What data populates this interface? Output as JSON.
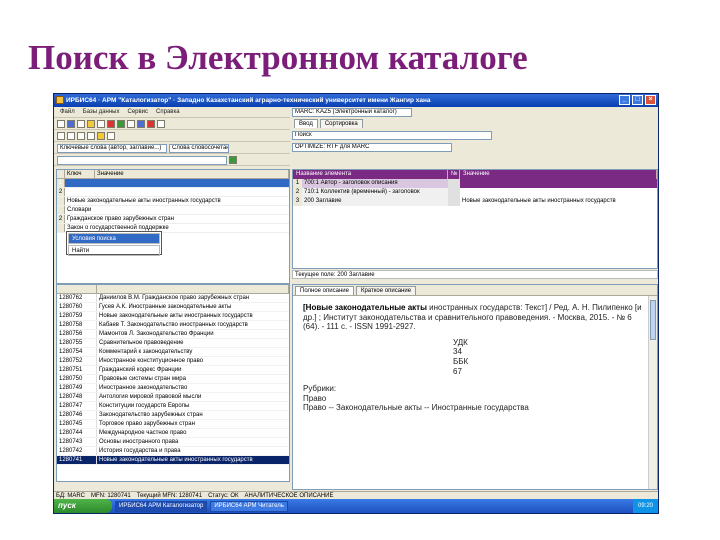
{
  "slide_title": "Поиск в Электронном каталоге",
  "window": {
    "title": "ИРБИС64 · АРМ \"Каталогизатор\" · Западно Казахстанский аграрно-технический университет имени Жангир хана",
    "minimize": "_",
    "maximize": "□",
    "close": "×"
  },
  "menu": [
    "Файл",
    "Базы данных",
    "Сервис",
    "Справка"
  ],
  "db_selector": "MARC: KAZ5 (Электронный каталог)",
  "search_combo": "Ключевые слова (автор, заглавие...)",
  "mode_combo": "Слова словосочетания",
  "format_combo": "OPTIMIZE: RTF для MARC",
  "right_tabs": [
    "Ввод",
    "Сортировка"
  ],
  "right_field": "Поиск",
  "left_grid": {
    "headers": [
      "Ключ",
      "Значение"
    ],
    "rows": [
      {
        "n": "1",
        "v": "",
        "sel": true
      },
      {
        "n": "2",
        "v": ""
      },
      {
        "n": "",
        "v": "Новые законодательные акты иностранных государств"
      },
      {
        "n": "",
        "v": "Словари"
      },
      {
        "n": "2",
        "v": "Гражданское право зарубежных стран"
      },
      {
        "n": "",
        "v": "Закон о государственной поддержке"
      }
    ]
  },
  "popup": {
    "items": [
      "Условия поиска",
      "Найти"
    ]
  },
  "right_grid": {
    "headers": [
      "Название элемента",
      "№",
      "Значение"
    ],
    "rows": [
      {
        "n": "1",
        "name": "700:1 Автор - заголовок описания",
        "val": "",
        "hl": true
      },
      {
        "n": "2",
        "name": "710:1 Коллектив (временный) - заголовок",
        "val": ""
      },
      {
        "n": "3",
        "name": "200 Заглавие",
        "val": "Новые законодательные акты иностранных государств"
      }
    ]
  },
  "status_line": "Текущее поле: 200 Заглавие",
  "left_list": {
    "rows": [
      {
        "id": "1280762",
        "t": "Даниилов В.М. Гражданское право зарубежных стран"
      },
      {
        "id": "1280760",
        "t": "Гусев А.К. Иностранные законодательные акты"
      },
      {
        "id": "1280759",
        "t": "Новые законодательные акты иностранных государств"
      },
      {
        "id": "1280758",
        "t": "Кабаев Т. Законодательство иностранных государств"
      },
      {
        "id": "1280756",
        "t": "Мамонтов Л. Законодательство Франции"
      },
      {
        "id": "1280755",
        "t": "Сравнительное правоведение"
      },
      {
        "id": "1280754",
        "t": "Комментарий к законодательству"
      },
      {
        "id": "1280752",
        "t": "Иностранное конституционное право"
      },
      {
        "id": "1280751",
        "t": "Гражданский кодекс Франции"
      },
      {
        "id": "1280750",
        "t": "Правовые системы стран мира"
      },
      {
        "id": "1280749",
        "t": "Иностранное законодательство"
      },
      {
        "id": "1280748",
        "t": "Антология мировой правовой мысли"
      },
      {
        "id": "1280747",
        "t": "Конституции государств Европы"
      },
      {
        "id": "1280746",
        "t": "Законодательство зарубежных стран"
      },
      {
        "id": "1280745",
        "t": "Торговое право зарубежных стран"
      },
      {
        "id": "1280744",
        "t": "Международное частное право"
      },
      {
        "id": "1280743",
        "t": "Основы иностранного права"
      },
      {
        "id": "1280742",
        "t": "История государства и права"
      },
      {
        "id": "1280741",
        "t": "Новые законодательные акты иностранных государств",
        "sel": true
      }
    ]
  },
  "doc": {
    "tabs": [
      "Полное описание",
      "Краткое описание"
    ],
    "bib_bold": "[Новые законодательные акты",
    "bib_rest": "иностранных государств: Текст] / Ред. А. Н. Пилипенко [и др.] ; Институт законодательства и сравнительного правоведения. - Москва, 2015. - № 6 (64). - 111 с. - ISSN 1991-2927.",
    "udk_label": "УДК",
    "udk_value": "34",
    "bbk_label": "ББК",
    "bbk_value": "67",
    "rubrics_label": "Рубрики:",
    "rubric_1": "Право",
    "rubric_2": "Право -- Законодательные акты -- Иностранные государства"
  },
  "win_status": [
    "БД: MARC",
    "MFN: 1280741",
    "Текущий MFN: 1280741",
    "Статус: ОК",
    "АНАЛИТИЧЕСКОЕ ОПИСАНИЕ"
  ],
  "taskbar": {
    "start": "пуск",
    "tasks": [
      "ИРБИС64 АРМ Каталогизатор",
      "ИРБИС64 АРМ Читатель"
    ],
    "clock": "09:20"
  }
}
